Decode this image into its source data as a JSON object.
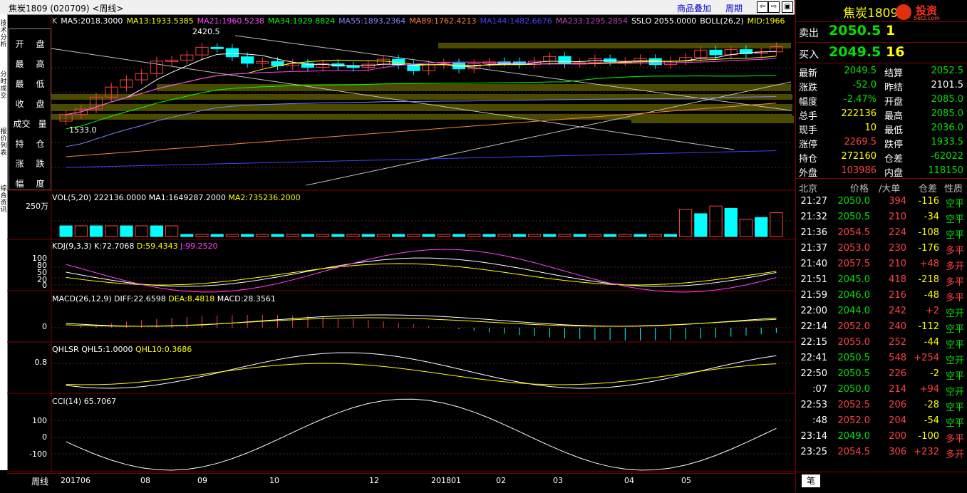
{
  "topbar": {
    "title": "焦炭1809 (020709) <周线>",
    "links": [
      "商品叠加",
      "周期"
    ],
    "nav_buttons": [
      "⇦",
      "⇨",
      "▣",
      "▣",
      "▣"
    ]
  },
  "left_tabs": [
    "技术分析",
    "分时成交",
    "报价列表",
    "综合资讯"
  ],
  "info_labels": [
    [
      "开",
      "盘"
    ],
    [
      "最",
      "高"
    ],
    [
      "最",
      "低"
    ],
    [
      "收",
      "盘"
    ],
    [
      "成交",
      "量"
    ],
    [
      "持",
      "仓"
    ],
    [
      "涨",
      "跌"
    ],
    [
      "幅",
      "度"
    ]
  ],
  "main_panel": {
    "title_parts": [
      {
        "text": "K",
        "color": "#c0c0c0"
      },
      {
        "text": "MA5:2018.3000",
        "color": "#ffffff"
      },
      {
        "text": "MA13:1933.5385",
        "color": "#ffff00"
      },
      {
        "text": "MA21:1960.5238",
        "color": "#ff40ff"
      },
      {
        "text": "MA34:1929.8824",
        "color": "#00ff00"
      },
      {
        "text": "MA55:1893.2364",
        "color": "#8080ff"
      },
      {
        "text": "MA89:1762.4213",
        "color": "#ff8040"
      },
      {
        "text": "MA144:1482.6676",
        "color": "#4040ff"
      },
      {
        "text": "MA233:1295.2854",
        "color": "#c040c0"
      },
      {
        "text": "SSLO 2055.0000",
        "color": "#ffffff"
      },
      {
        "text": "BOLL(26,2)",
        "color": "#ffffff"
      },
      {
        "text": "MID:1966",
        "color": "#ffff00"
      }
    ],
    "high_label": "2420.5",
    "low_label": "1533.0"
  },
  "vol_panel": {
    "title": "VOL(5,20) 222136.0000",
    "ma1": "MA1:1649287.2000",
    "ma2": "MA2:735236.2000",
    "ylabel": "250万"
  },
  "kdj_panel": {
    "title": "KDJ(9,3,3)",
    "k": "K:72.7068",
    "d": "D:59.4343",
    "j": "J:99.2520",
    "yticks": [
      "100",
      "80",
      "50",
      "20",
      "0"
    ]
  },
  "macd_panel": {
    "title": "MACD(26,12,9)",
    "diff": "DIFF:22.6598",
    "dea": "DEA:8.4818",
    "macd": "MACD:28.3561",
    "yticks": [
      "0"
    ]
  },
  "qhlsr_panel": {
    "title": "QHLSR",
    "q5": "QHL5:1.0000",
    "q10": "QHL10:0.3686",
    "yticks": [
      "0.8"
    ]
  },
  "cci_panel": {
    "title": "CCI(14)",
    "value": "65.7067",
    "yticks": [
      "100",
      "0",
      "-100"
    ]
  },
  "x_axis": {
    "period": "周线",
    "labels": [
      "201706",
      "08",
      "09",
      "10",
      "12",
      "201801",
      "02",
      "03",
      "04",
      "05"
    ]
  },
  "right_panel": {
    "name": "焦炭1809（",
    "logo": "投资",
    "logo_sub": "5etz.com",
    "sell": {
      "label": "卖出",
      "price": "2050.5",
      "qty": "1"
    },
    "buy": {
      "label": "买入",
      "price": "2049.5",
      "qty": "16"
    },
    "stats": [
      [
        "最新",
        "2049.5",
        "结算",
        "2052.5"
      ],
      [
        "涨跌",
        "-52.0",
        "昨结",
        "2101.5"
      ],
      [
        "幅度",
        "-2.47%",
        "开盘",
        "2085.0"
      ],
      [
        "总手",
        "222136",
        "最高",
        "2085.0"
      ],
      [
        "现手",
        "10",
        "最低",
        "2036.0"
      ],
      [
        "涨停",
        "2269.5",
        "跌停",
        "1933.5"
      ],
      [
        "持仓",
        "272160",
        "仓差",
        "-62022"
      ],
      [
        "外盘",
        "103986",
        "内盘",
        "118150"
      ]
    ],
    "tick_header": [
      "北京",
      "价格",
      "∕大单",
      "仓差",
      "性质"
    ],
    "ticks": [
      [
        "21:27",
        "2050.0",
        "394",
        "-116",
        "空平"
      ],
      [
        "21:32",
        "2050.5",
        "210",
        "-34",
        "空平"
      ],
      [
        "21:36",
        "2054.5",
        "224",
        "-108",
        "空平"
      ],
      [
        "21:37",
        "2053.0",
        "230",
        "-176",
        "多平"
      ],
      [
        "21:40",
        "2057.5",
        "210",
        "+48",
        "多开"
      ],
      [
        "21:51",
        "2045.0",
        "418",
        "-218",
        "多平"
      ],
      [
        "21:59",
        "2046.0",
        "216",
        "-48",
        "多平"
      ],
      [
        "22:00",
        "2044.0",
        "242",
        "+2",
        "空开"
      ],
      [
        "22:14",
        "2052.0",
        "240",
        "-112",
        "空平"
      ],
      [
        "22:15",
        "2055.0",
        "252",
        "-44",
        "空平"
      ],
      [
        "22:41",
        "2050.5",
        "548",
        "+254",
        "空开"
      ],
      [
        "22:50",
        "2050.5",
        "226",
        "-2",
        "空平"
      ],
      [
        ":07",
        "2050.0",
        "214",
        "+94",
        "空开"
      ],
      [
        "22:53",
        "2052.5",
        "206",
        "-28",
        "空平"
      ],
      [
        ":48",
        "2052.0",
        "204",
        "-54",
        "空平"
      ],
      [
        "23:14",
        "2049.0",
        "200",
        "-100",
        "多平"
      ],
      [
        "23:25",
        "2054.5",
        "306",
        "+232",
        "多开"
      ]
    ],
    "bottom_tab": "笔"
  },
  "colors": {
    "up": "#ff4040",
    "down": "#00ffff",
    "bg": "#000000",
    "grid": "#800000"
  }
}
